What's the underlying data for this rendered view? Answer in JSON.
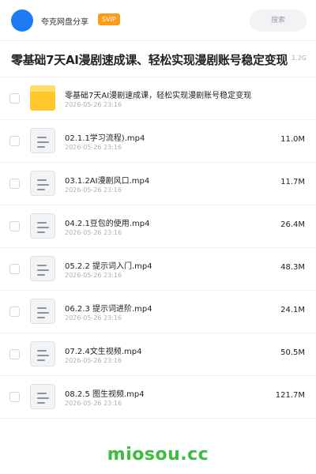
{
  "header": {
    "app_name": "夸克网盘分享",
    "badge": "SVIP",
    "search_label": "搜索",
    "avatar_color": "#1e7bf5",
    "badge_color": "#ff9b1a"
  },
  "share": {
    "title": "零基础7天AI漫剧速成课、轻松实现漫剧账号稳定变现",
    "total_size": "1.2G"
  },
  "files": [
    {
      "name": "零基础7天AI漫剧速成课，轻松实现漫剧账号稳定变现",
      "date": "2026-05-26 23:16",
      "size": "",
      "type": "folder"
    },
    {
      "name": "02.1.1学习流程).mp4",
      "date": "2026-05-26 23:16",
      "size": "11.0M",
      "type": "file"
    },
    {
      "name": "03.1.2AI漫剧风口.mp4",
      "date": "2026-05-26 23:16",
      "size": "11.7M",
      "type": "file"
    },
    {
      "name": "04.2.1豆包的使用.mp4",
      "date": "2026-05-26 23:16",
      "size": "26.4M",
      "type": "file"
    },
    {
      "name": "05.2.2 提示词入门.mp4",
      "date": "2026-05-26 23:16",
      "size": "48.3M",
      "type": "file"
    },
    {
      "name": "06.2.3 提示词进阶.mp4",
      "date": "2026-05-26 23:16",
      "size": "24.1M",
      "type": "file"
    },
    {
      "name": "07.2.4文生视频.mp4",
      "date": "2026-05-26 23:16",
      "size": "50.5M",
      "type": "file"
    },
    {
      "name": "08.2.5 图生视频.mp4",
      "date": "2026-05-26 23:16",
      "size": "121.7M",
      "type": "file"
    }
  ],
  "watermark": "miosou.cc"
}
